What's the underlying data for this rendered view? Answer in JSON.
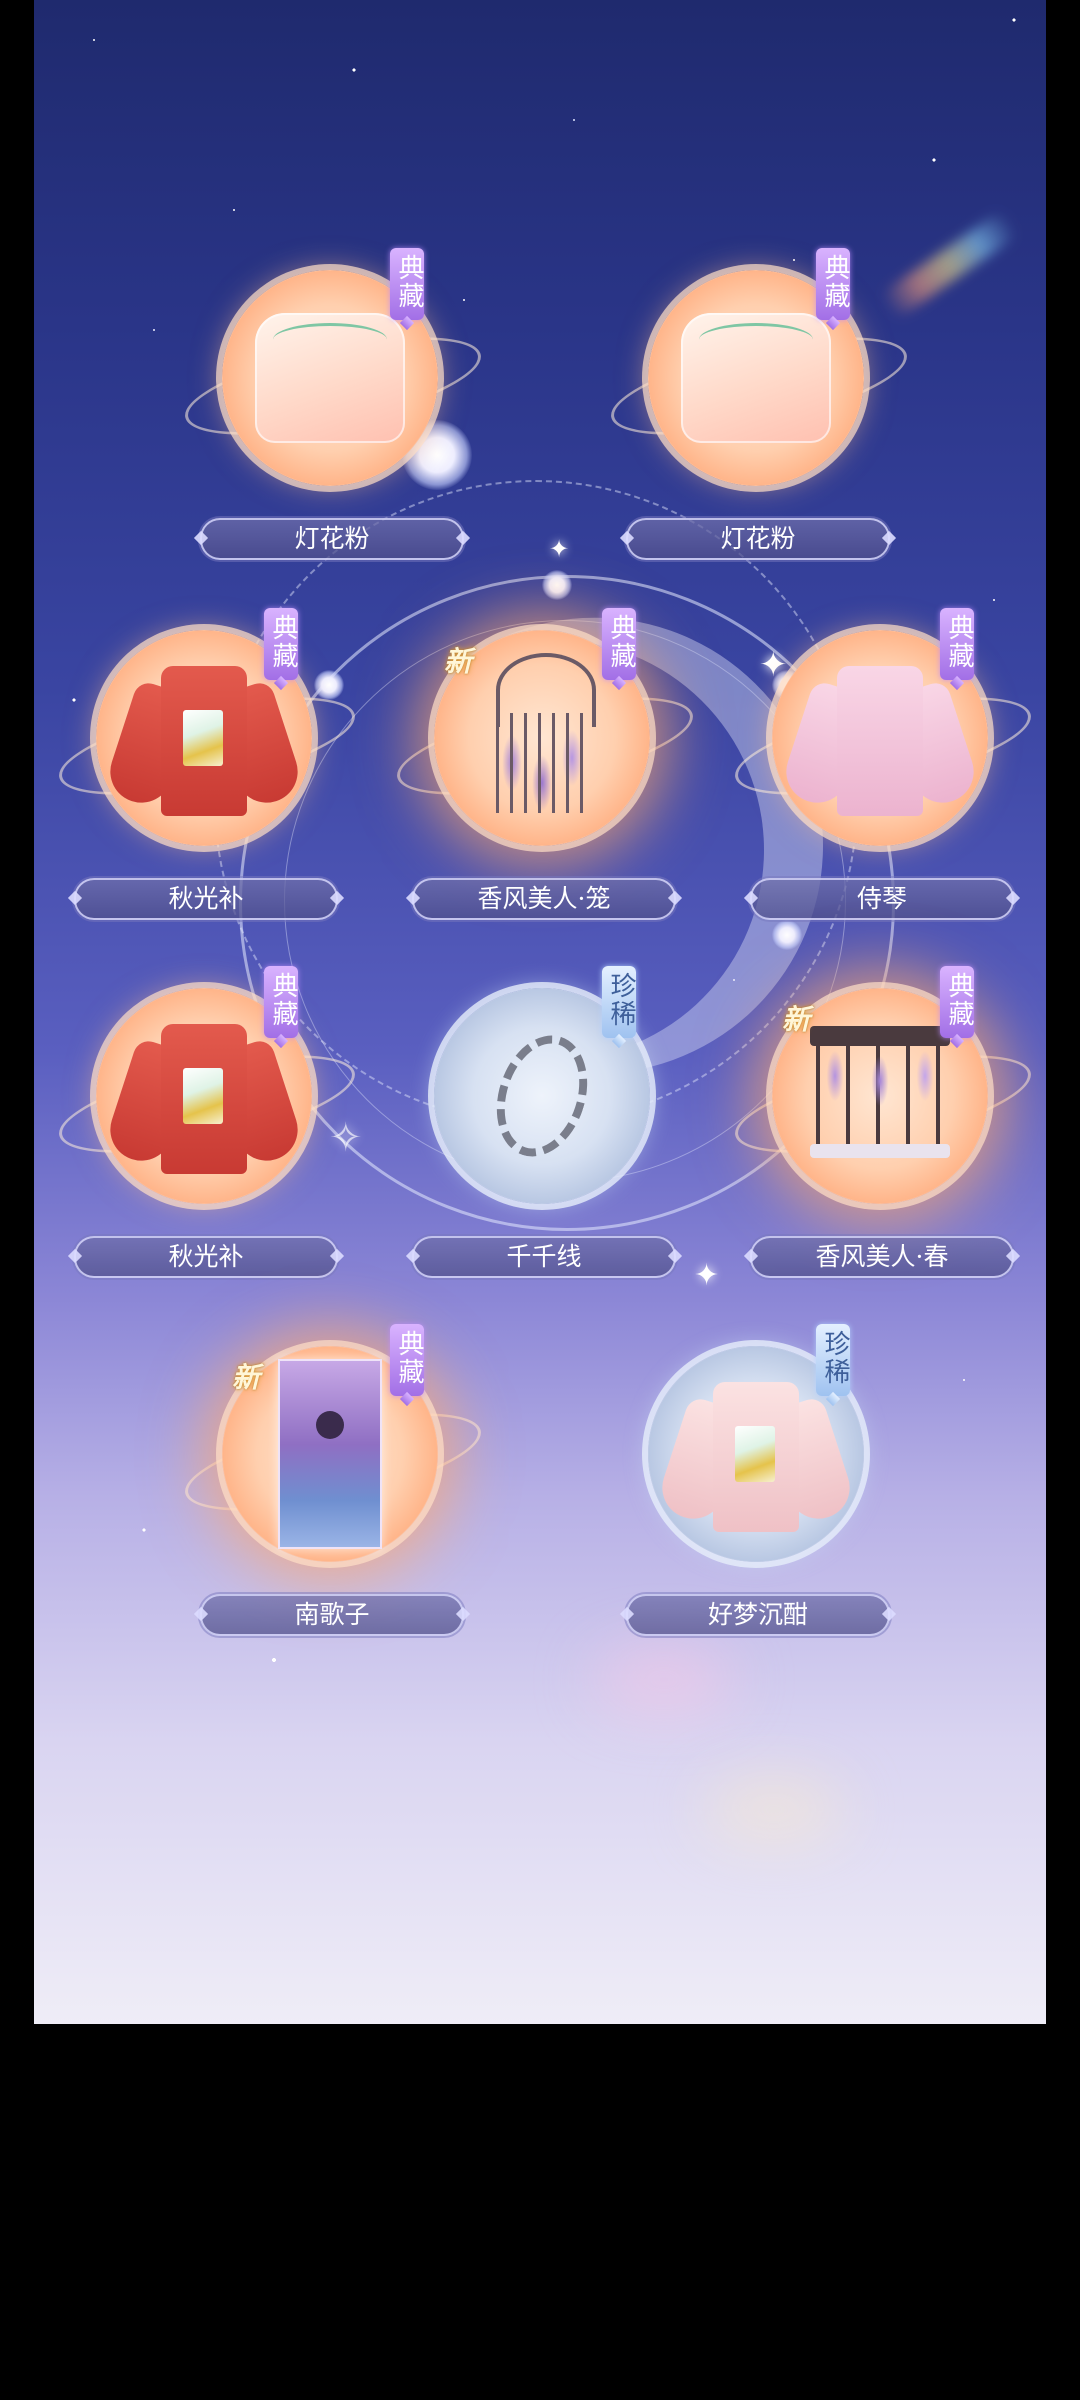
{
  "tags": {
    "dian": "典藏",
    "zhen": "珍稀",
    "new": "新"
  },
  "items": [
    {
      "name": "灯花粉",
      "tag": "典藏",
      "new": false
    },
    {
      "name": "灯花粉",
      "tag": "典藏",
      "new": false
    },
    {
      "name": "秋光补",
      "tag": "典藏",
      "new": false
    },
    {
      "name": "香风美人·笼",
      "tag": "典藏",
      "new": true
    },
    {
      "name": "侍琴",
      "tag": "典藏",
      "new": false
    },
    {
      "name": "秋光补",
      "tag": "典藏",
      "new": false
    },
    {
      "name": "千千线",
      "tag": "珍稀",
      "new": false
    },
    {
      "name": "香风美人·春",
      "tag": "典藏",
      "new": true
    },
    {
      "name": "南歌子",
      "tag": "典藏",
      "new": true
    },
    {
      "name": "好梦沉酣",
      "tag": "珍稀",
      "new": false
    }
  ],
  "colors": {
    "sky_top": "#1f2a6e",
    "sky_bottom": "#efedf7",
    "tag_dian": "#a26fe6",
    "tag_zhen": "#9fc2f0",
    "medallion_peach": "#ffc9a3"
  }
}
